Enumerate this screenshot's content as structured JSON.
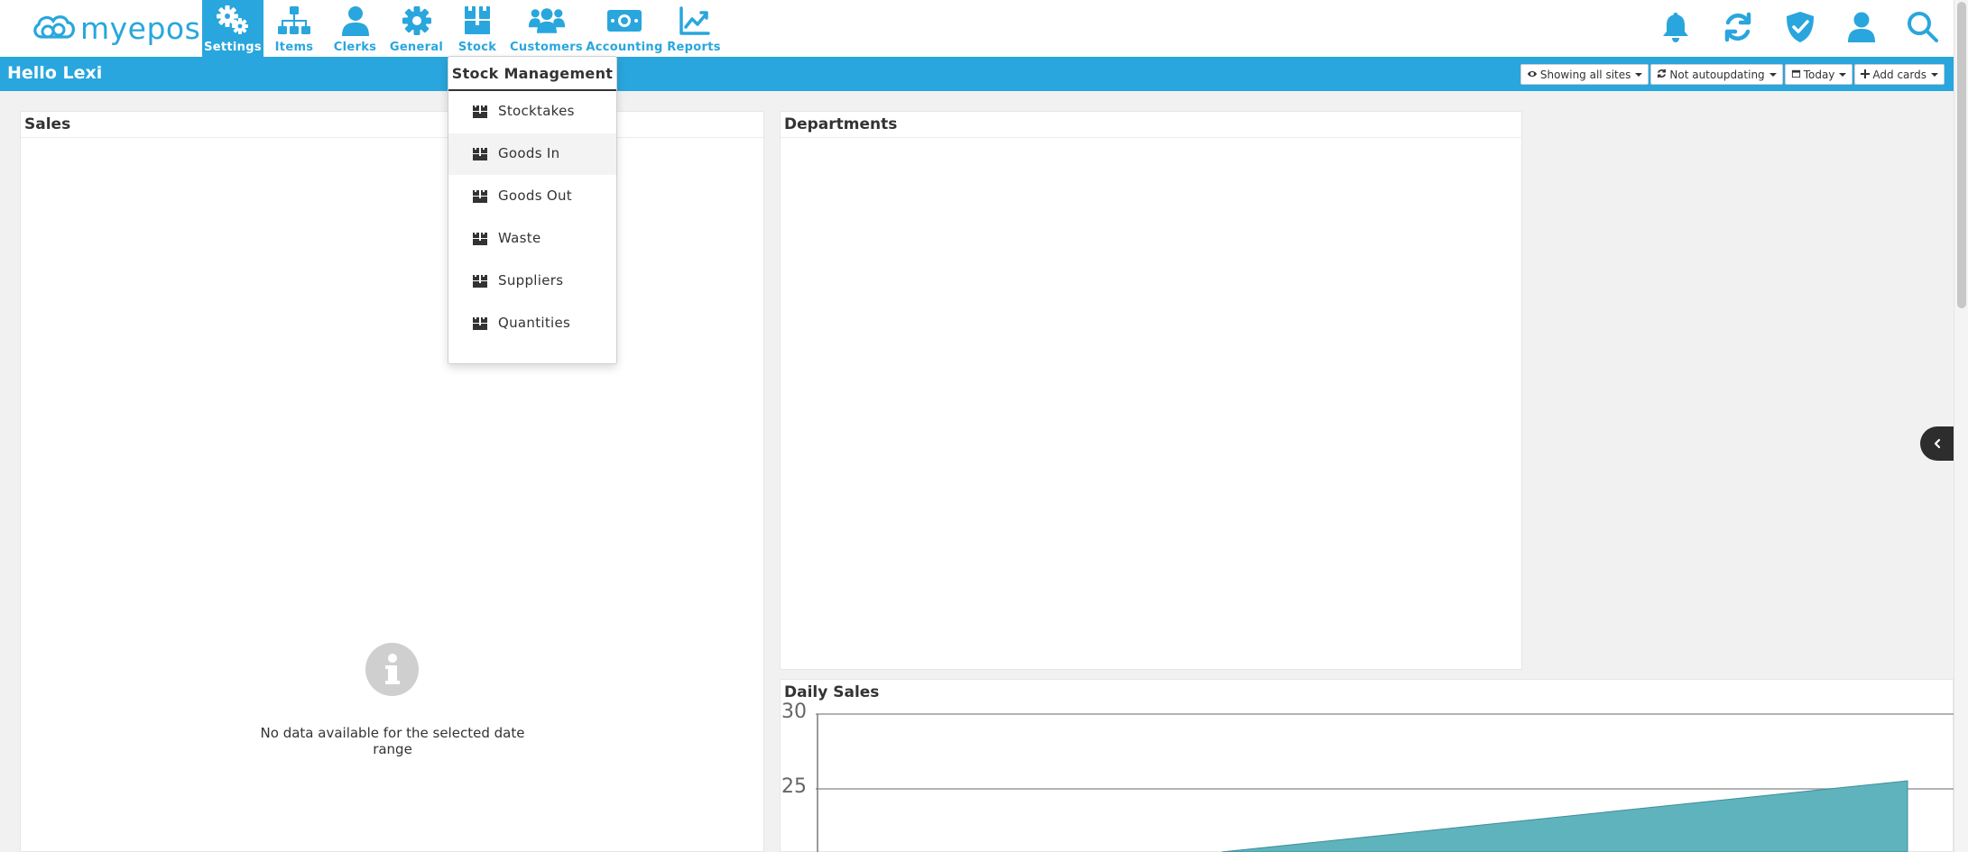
{
  "app": {
    "logo_text": "myepos"
  },
  "nav": {
    "items": [
      {
        "label": "Settings",
        "icon": "gears-icon"
      },
      {
        "label": "Items",
        "icon": "sitemap-icon"
      },
      {
        "label": "Clerks",
        "icon": "user-icon"
      },
      {
        "label": "General",
        "icon": "gear-icon"
      },
      {
        "label": "Stock",
        "icon": "boxes-icon"
      },
      {
        "label": "Customers",
        "icon": "users-icon"
      },
      {
        "label": "Accounting",
        "icon": "money-icon"
      },
      {
        "label": "Reports",
        "icon": "chart-line-icon"
      }
    ],
    "active": "Settings",
    "right_icons": [
      "bell-icon",
      "refresh-icon",
      "shield-check-icon",
      "user-icon",
      "search-icon"
    ]
  },
  "header": {
    "greeting": "Hello Lexi",
    "buttons": {
      "sites": "Showing all sites",
      "autoupdate": "Not autoupdating",
      "date": "Today",
      "add_cards": "Add cards"
    }
  },
  "dropdown": {
    "title": "Stock Management",
    "items": [
      "Stocktakes",
      "Goods In",
      "Goods Out",
      "Waste",
      "Suppliers",
      "Quantities"
    ],
    "highlighted": "Goods In"
  },
  "cards": {
    "sales": {
      "title": "Sales",
      "empty_message": "No data available for the selected date range"
    },
    "departments": {
      "title": "Departments"
    },
    "daily_sales": {
      "title": "Daily Sales"
    }
  },
  "chart_data": {
    "type": "area",
    "title": "Daily Sales",
    "y_ticks": [
      "30",
      "25"
    ],
    "series_color": "#5fb3bd"
  },
  "colors": {
    "brand": "#29a6dd",
    "accent_dark": "#2d2d2d"
  }
}
